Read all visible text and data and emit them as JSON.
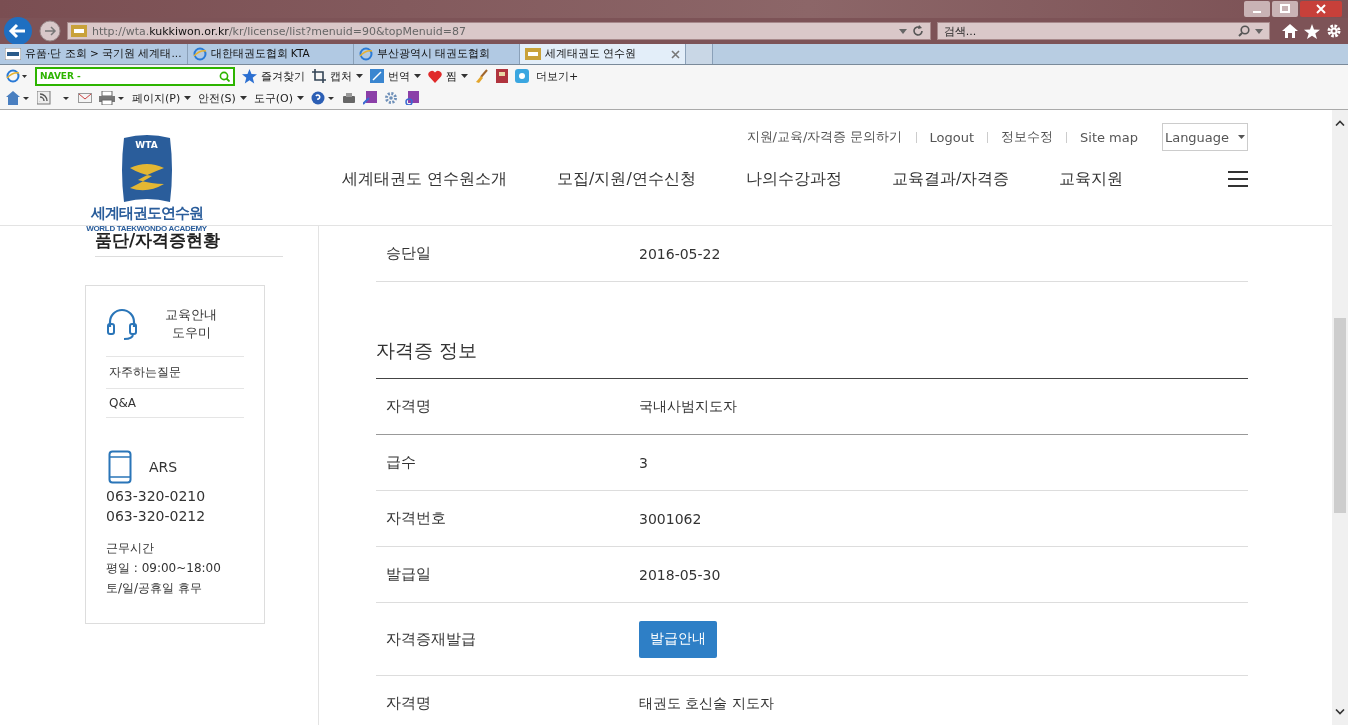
{
  "browser": {
    "address": "http://wta.**kukkiwon.or.kr**/kr/license/list?menuid=90&topMenuid=87",
    "search_placeholder": "검색...",
    "tabs": [
      {
        "label": "유품·단 조회 > 국기원 세계태...",
        "selected": false,
        "kind": "flag"
      },
      {
        "label": "대한태권도협회 KTA",
        "selected": false,
        "kind": "globe"
      },
      {
        "label": "부산광역시 태권도협회",
        "selected": false,
        "kind": "globe"
      },
      {
        "label": "세계태권도 연수원",
        "selected": true,
        "kind": "site"
      }
    ],
    "naver_box": "NAVER -",
    "toolbar": [
      {
        "label": "즐겨찾기",
        "kind": "star"
      },
      {
        "label": "캡처",
        "kind": "capture"
      },
      {
        "label": "번역",
        "kind": "translate"
      },
      {
        "label": "찜",
        "kind": "heart"
      },
      {
        "label": "더보기+",
        "kind": "more"
      }
    ],
    "command_bar": [
      "페이지(P)",
      "안전(S)",
      "도구(O)"
    ]
  },
  "site": {
    "logo": {
      "badge": "WTA",
      "name": "세계태권도연수원",
      "subtitle": "WORLD TAEKWONDO ACADEMY"
    },
    "util_links": [
      "지원/교육/자격증 문의하기",
      "Logout",
      "정보수정",
      "Site map"
    ],
    "language": "Language",
    "nav": [
      "세계태권도 연수원소개",
      "모집/지원/연수신청",
      "나의수강과정",
      "교육결과/자격증",
      "교육지원"
    ]
  },
  "sidebar": {
    "heading": "품단/자격증현황",
    "help": {
      "title": "교육안내\n도우미",
      "links": [
        "자주하는질문",
        "Q&A"
      ]
    },
    "ars": {
      "label": "ARS",
      "phones": [
        "063-320-0210",
        "063-320-0212"
      ],
      "hours": [
        "근무시간",
        "평일 : 09:00~18:00",
        "토/일/공휴일 휴무"
      ]
    }
  },
  "content": {
    "top_rows": [
      {
        "label": "승단일",
        "value": "2016-05-22",
        "kind": "text"
      }
    ],
    "section_title": "자격증 정보",
    "rows": [
      {
        "label": "자격명",
        "value": "국내사범지도자",
        "kind": "text"
      },
      {
        "label": "급수",
        "value": "3",
        "kind": "text"
      },
      {
        "label": "자격번호",
        "value": "3001062",
        "kind": "text"
      },
      {
        "label": "발급일",
        "value": "2018-05-30",
        "kind": "text"
      },
      {
        "label": "자격증재발급",
        "value": "발급안내",
        "kind": "button"
      },
      {
        "label": "자격명",
        "value": "태권도 호신술 지도자",
        "kind": "text"
      }
    ]
  }
}
